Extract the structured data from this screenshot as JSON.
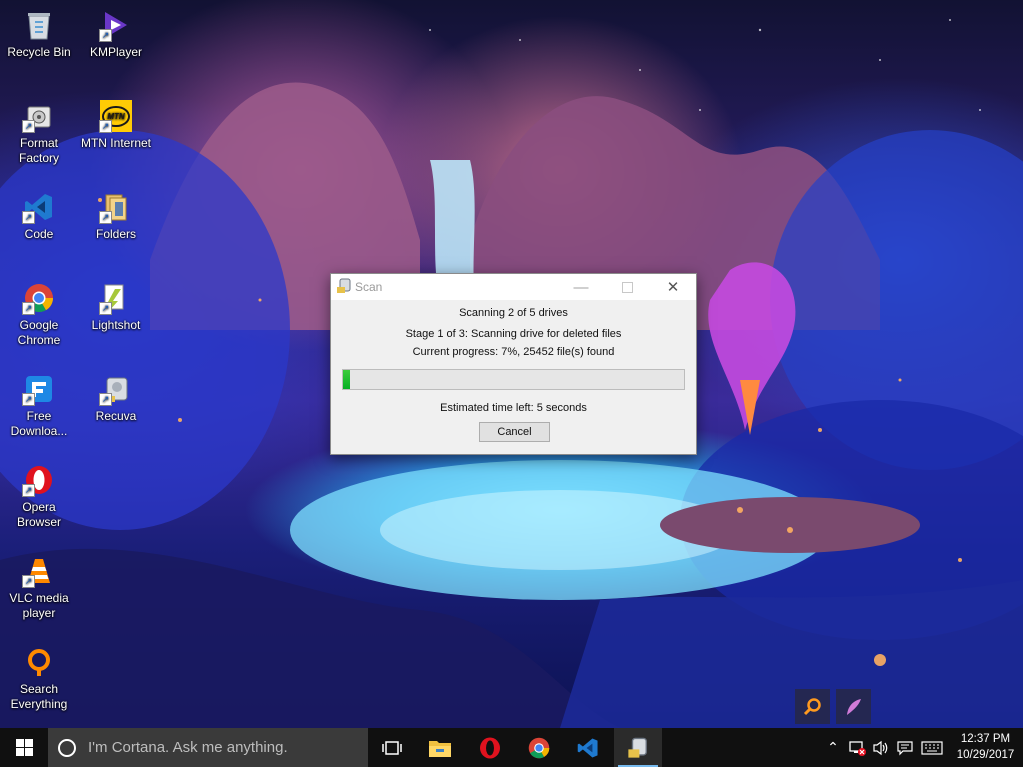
{
  "desktop": {
    "icons": [
      {
        "id": "recycle-bin",
        "label": "Recycle Bin"
      },
      {
        "id": "kmplayer",
        "label": "KMPlayer"
      },
      {
        "id": "format-factory",
        "label": "Format\nFactory"
      },
      {
        "id": "mtn-internet",
        "label": "MTN Internet"
      },
      {
        "id": "code",
        "label": "Code"
      },
      {
        "id": "folders",
        "label": "Folders"
      },
      {
        "id": "google-chrome",
        "label": "Google\nChrome"
      },
      {
        "id": "lightshot",
        "label": "Lightshot"
      },
      {
        "id": "free-download",
        "label": "Free\nDownloa..."
      },
      {
        "id": "recuva",
        "label": "Recuva"
      },
      {
        "id": "opera",
        "label": "Opera\nBrowser"
      },
      {
        "id": "vlc",
        "label": "VLC media\nplayer"
      },
      {
        "id": "search-everything",
        "label": "Search\nEverything"
      }
    ],
    "mtn_logo_text": "MTN"
  },
  "dialog": {
    "title": "Scan",
    "line1": "Scanning 2 of 5 drives",
    "line2": "Stage 1 of 3: Scanning drive for deleted files",
    "line3": "Current progress: 7%, 25452 file(s) found",
    "progress_fraction": 0.02,
    "eta": "Estimated time left: 5 seconds",
    "cancel_label": "Cancel"
  },
  "taskbar": {
    "search_placeholder": "I'm Cortana. Ask me anything.",
    "time": "12:37 PM",
    "date": "10/29/2017",
    "apps": [
      "task-view",
      "file-explorer",
      "opera",
      "chrome",
      "visual-studio-code",
      "recuva"
    ]
  },
  "colors": {
    "taskbar": "#101010",
    "search_box": "#3a3a3a",
    "progress_green": "#06b025",
    "active_indicator": "#76b9ed"
  }
}
